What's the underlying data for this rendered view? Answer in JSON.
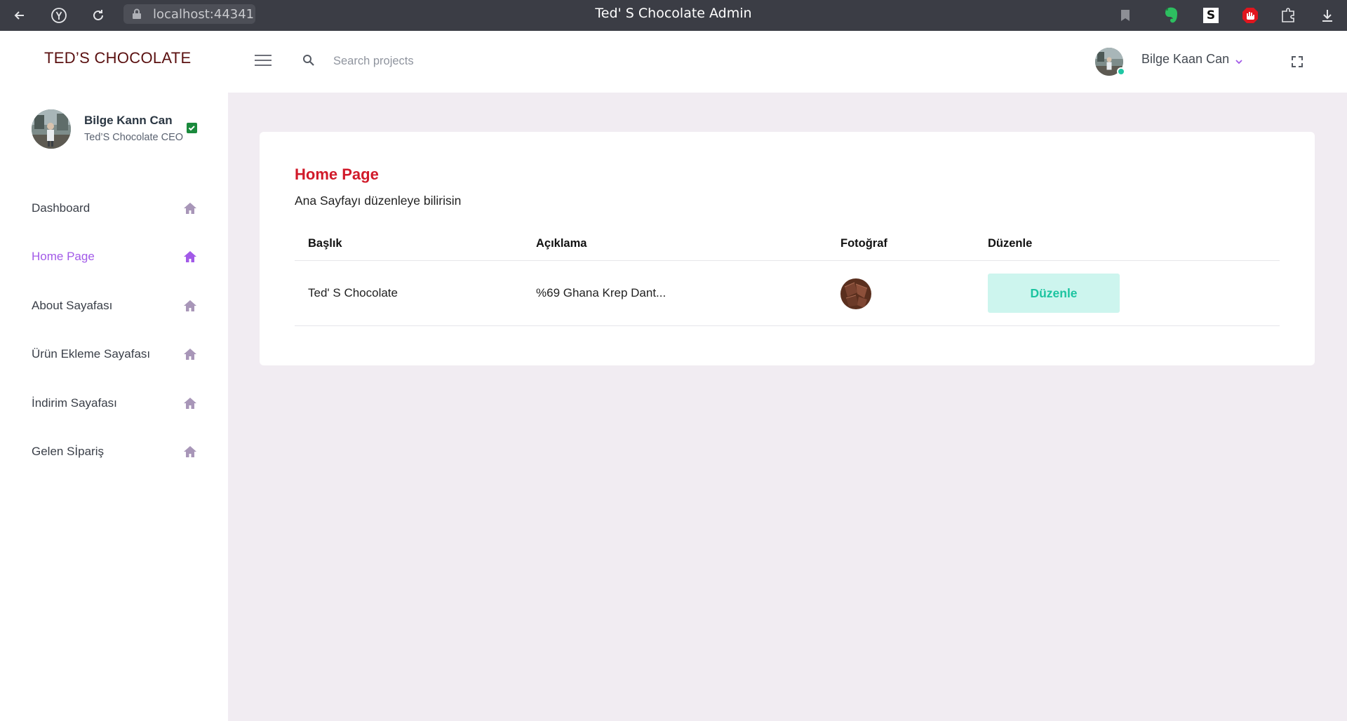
{
  "browser": {
    "url": "localhost:44341",
    "window_title": "Ted' S Chocolate Admin"
  },
  "sidebar": {
    "brand": "TED’S CHOCOLATE",
    "profile": {
      "name": "Bilge Kann Can",
      "role": "Ted’S Chocolate CEO"
    },
    "items": [
      {
        "label": "Dashboard",
        "active": false
      },
      {
        "label": "Home Page",
        "active": true
      },
      {
        "label": "About Sayafası",
        "active": false
      },
      {
        "label": "Ürün Ekleme Sayafası",
        "active": false
      },
      {
        "label": "İndirim Sayafası",
        "active": false
      },
      {
        "label": "Gelen Sİpariş",
        "active": false
      }
    ]
  },
  "header": {
    "search_placeholder": "Search projects",
    "user_name": "Bilge Kaan Can"
  },
  "main": {
    "title": "Home Page",
    "subtitle": "Ana Sayfayı düzenleye bilirisin",
    "table": {
      "columns": [
        "Başlık",
        "Açıklama",
        "Fotoğraf",
        "Düzenle"
      ],
      "rows": [
        {
          "title": "Ted' S Chocolate",
          "description": "%69 Ghana Krep Dant...",
          "edit_label": "Düzenle"
        }
      ]
    }
  },
  "colors": {
    "accent_purple": "#a25ae8",
    "title_red": "#d11a2a",
    "teal": "#1cc4a0",
    "teal_bg": "#cdf5ee",
    "browser_bar": "#3b3d45"
  }
}
